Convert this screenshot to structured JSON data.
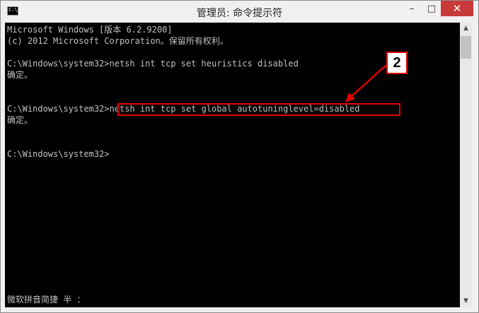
{
  "window": {
    "title": "管理员: 命令提示符",
    "icon": "cmd-icon",
    "icon_glyph": "C:\\",
    "controls": {
      "minimize": "–",
      "maximize": "□",
      "close": "✕"
    }
  },
  "console": {
    "lines": [
      "Microsoft Windows [版本 6.2.9200]",
      "(c) 2012 Microsoft Corporation。保留所有权利。",
      "",
      "C:\\Windows\\system32>netsh int tcp set heuristics disabled",
      "确定。",
      "",
      "",
      "C:\\Windows\\system32>netsh int tcp set global autotuninglevel=disabled",
      "确定。",
      "",
      "",
      "C:\\Windows\\system32>"
    ],
    "ime_status": "微软拼音简捷 半 ：",
    "colors": {
      "background": "#000000",
      "text": "#c0c0c0"
    }
  },
  "scrollbar": {
    "up_arrow": "▲",
    "down_arrow": "▼"
  },
  "annotation": {
    "callout_label": "2",
    "color": "#e00000"
  }
}
